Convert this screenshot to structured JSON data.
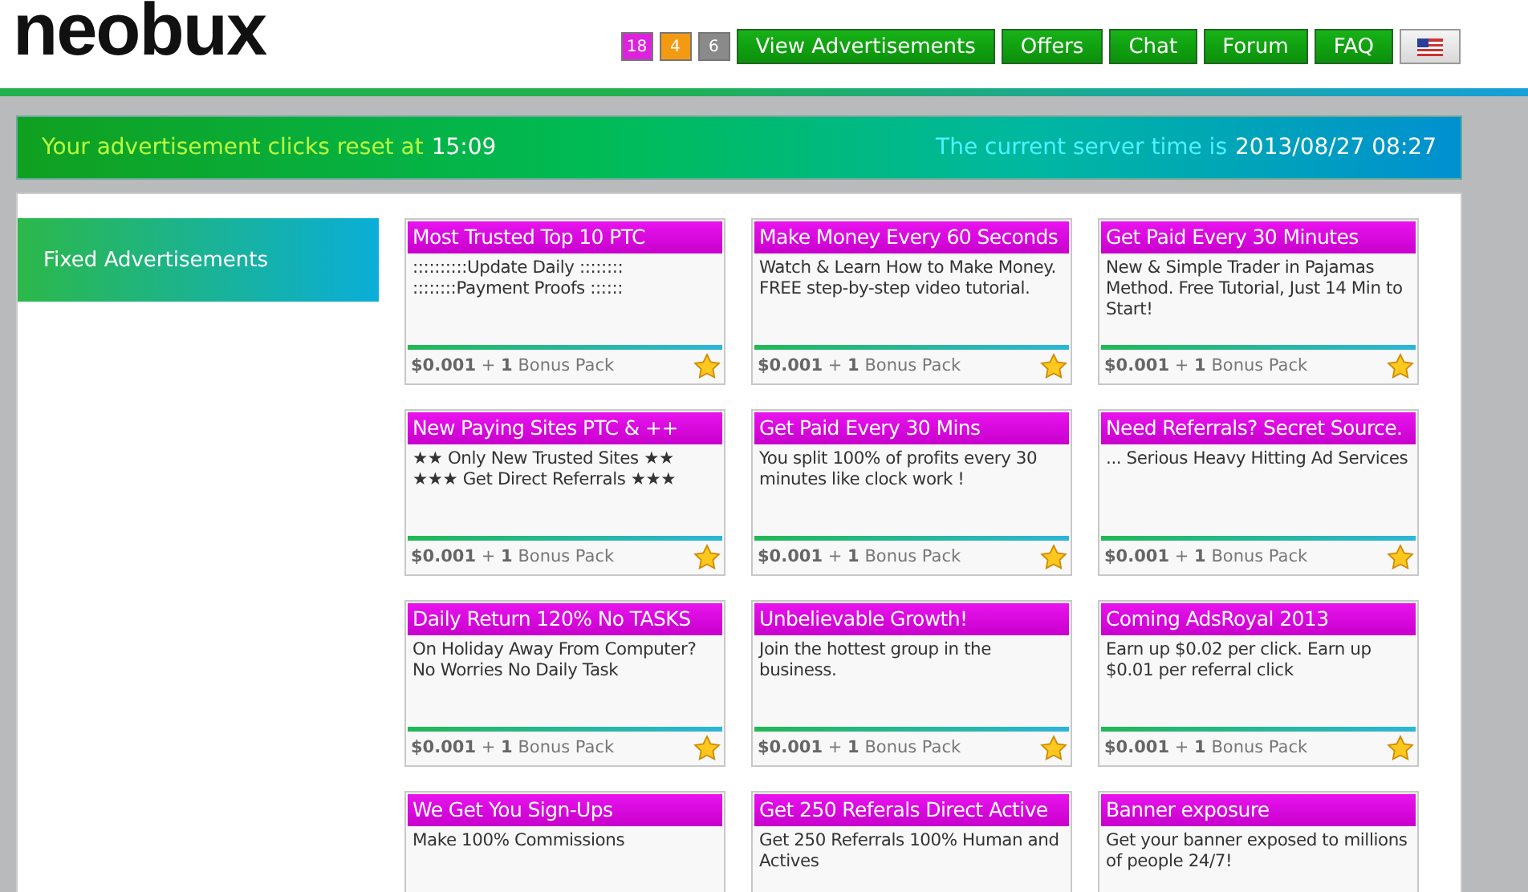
{
  "logo": "neobux",
  "badges": [
    {
      "label": "18",
      "color": "#dd22dd"
    },
    {
      "label": "4",
      "color": "#f39a12"
    },
    {
      "label": "6",
      "color": "#8a8a8a"
    }
  ],
  "nav": [
    "View Advertisements",
    "Offers",
    "Chat",
    "Forum",
    "FAQ"
  ],
  "status": {
    "reset_label": "Your advertisement clicks reset at",
    "reset_time": "15:09",
    "server_label": "The current server time is",
    "server_time": "2013/08/27 08:27"
  },
  "sidebar": [
    {
      "label": "Fixed Advertisements",
      "selected": true
    }
  ],
  "ads": [
    {
      "title": "Most Trusted Top 10 PTC",
      "text": "::::::::::Update Daily :::::::: ::::::::Payment Proofs ::::::",
      "price": "$0.001",
      "plus": "+",
      "count": "1",
      "bonus": "Bonus Pack"
    },
    {
      "title": "Make Money Every 60 Seconds",
      "text": "Watch & Learn How to Make Money. FREE step-by-step video tutorial.",
      "price": "$0.001",
      "plus": "+",
      "count": "1",
      "bonus": "Bonus Pack"
    },
    {
      "title": "Get Paid Every 30 Minutes",
      "text": "New & Simple Trader in Pajamas Method. Free Tutorial, Just 14 Min to Start!",
      "price": "$0.001",
      "plus": "+",
      "count": "1",
      "bonus": "Bonus Pack"
    },
    {
      "title": "New Paying Sites PTC & ++",
      "text": "★★ Only New Trusted Sites ★★ ★★★ Get Direct Referrals ★★★",
      "price": "$0.001",
      "plus": "+",
      "count": "1",
      "bonus": "Bonus Pack"
    },
    {
      "title": "Get Paid Every 30 Mins",
      "text": "You split 100% of profits every 30 minutes like clock work !",
      "price": "$0.001",
      "plus": "+",
      "count": "1",
      "bonus": "Bonus Pack"
    },
    {
      "title": "Need Referrals? Secret Source.",
      "text": "... Serious Heavy Hitting Ad Services",
      "price": "$0.001",
      "plus": "+",
      "count": "1",
      "bonus": "Bonus Pack"
    },
    {
      "title": "Daily Return 120% No TASKS",
      "text": "On Holiday Away From Computer? No Worries No Daily Task",
      "price": "$0.001",
      "plus": "+",
      "count": "1",
      "bonus": "Bonus Pack"
    },
    {
      "title": "Unbelievable Growth!",
      "text": "Join the hottest group in the business.",
      "price": "$0.001",
      "plus": "+",
      "count": "1",
      "bonus": "Bonus Pack"
    },
    {
      "title": "Coming AdsRoyal 2013",
      "text": "Earn up $0.02 per click. Earn up $0.01 per referral click",
      "price": "$0.001",
      "plus": "+",
      "count": "1",
      "bonus": "Bonus Pack"
    },
    {
      "title": "We Get You Sign-Ups",
      "text": "Make 100% Commissions"
    },
    {
      "title": "Get 250 Referals Direct Active",
      "text": "Get 250 Referrals 100% Human and Actives"
    },
    {
      "title": "Banner exposure",
      "text": "Get your banner exposed to millions of people 24/7!"
    }
  ]
}
